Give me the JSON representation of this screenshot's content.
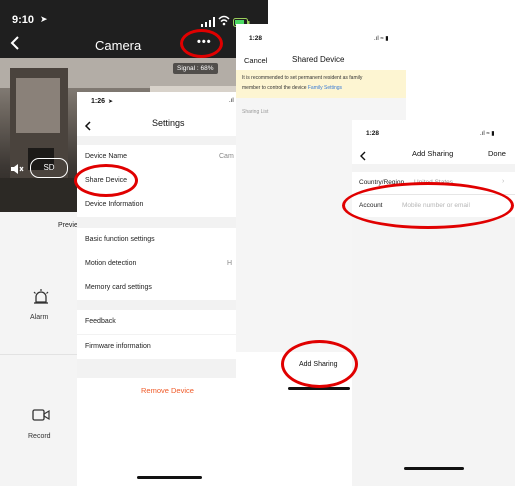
{
  "camera": {
    "time": "9:10",
    "title": "Camera",
    "more_label": "•••",
    "signal": "Signal : 68%",
    "sd_label": "SD",
    "tab_preview": "Previe",
    "alarm_label": "Alarm",
    "record_label": "Record"
  },
  "settings": {
    "time": "1:26",
    "title": "Settings",
    "device_name_label": "Device Name",
    "device_name_value": "Cam",
    "share_device": "Share Device",
    "device_information": "Device Information",
    "basic_function": "Basic function settings",
    "motion_detection": "Motion detection",
    "motion_value": "H",
    "memory_card": "Memory card settings",
    "feedback": "Feedback",
    "firmware": "Firmware information",
    "remove_device": "Remove Device"
  },
  "shared": {
    "time": "1:28",
    "cancel": "Cancel",
    "title": "Shared Device",
    "notice_line1": "It is recommended to set permanent resident as family",
    "notice_line2": "member to control the device ",
    "notice_link": "Family Settings",
    "sharing_list": "Sharing List",
    "add_sharing": "Add Sharing"
  },
  "add": {
    "time": "1:28",
    "title": "Add Sharing",
    "done": "Done",
    "country_label": "Country/Region",
    "country_value": "United States",
    "account_label": "Account",
    "account_placeholder": "Mobile number or email"
  },
  "colors": {
    "accent_red": "#e00000",
    "remove_orange": "#f05a28",
    "link_blue": "#3a7bd5",
    "notice_bg": "#fdf5d2"
  }
}
